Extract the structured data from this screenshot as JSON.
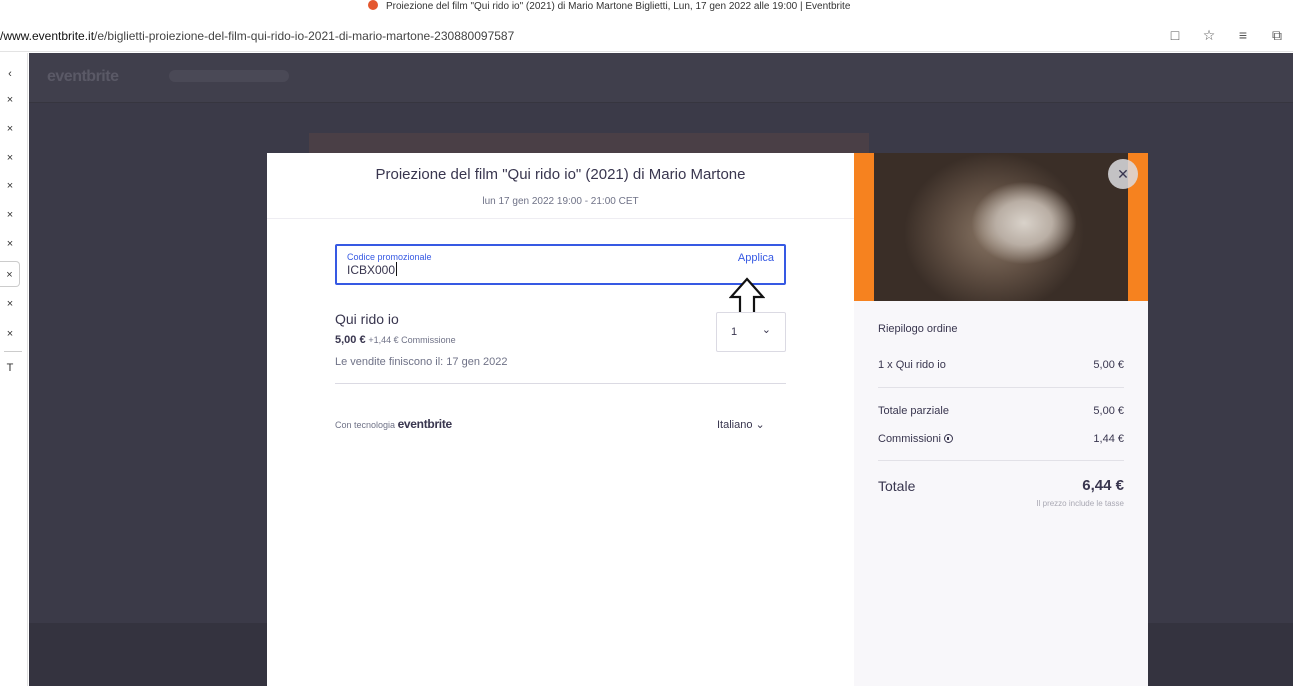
{
  "browser": {
    "tab_title": "Proiezione del film \"Qui rido io\" (2021) di Mario Martone Biglietti, Lun, 17 gen 2022 alle 19:00 | Eventbrite",
    "url_host": "/www.eventbrite.it",
    "url_path": "/e/biglietti-proiezione-del-film-qui-rido-io-2021-di-mario-martone-230880097587",
    "icons": [
      "reading-view-icon",
      "favorite-icon",
      "favorites-bar-icon",
      "collections-icon"
    ]
  },
  "vertical_tabs": {
    "collapse_glyph": "‹",
    "close_glyph": "×",
    "items_count_visible": 9,
    "last_glyph": "T"
  },
  "background_site": {
    "logo": "eventbrite"
  },
  "event": {
    "title": "Proiezione del film \"Qui rido io\" (2021) di Mario Martone",
    "date": "lun 17 gen 2022 19:00 - 21:00 CET"
  },
  "promo": {
    "label": "Codice promozionale",
    "value": "ICBX000",
    "apply_label": "Applica"
  },
  "ticket": {
    "name": "Qui rido io",
    "price": "5,00 €",
    "fee": "+1,44 € Commissione",
    "sales_end": "Le vendite finiscono il: 17 gen 2022",
    "quantity": "1"
  },
  "footer": {
    "powered_prefix": "Con tecnologia",
    "powered_brand": "eventbrite",
    "language": "Italiano"
  },
  "order": {
    "title": "Riepilogo ordine",
    "line_label": "1 x Qui rido io",
    "line_value": "5,00 €",
    "subtotal_label": "Totale parziale",
    "subtotal_value": "5,00 €",
    "fees_label": "Commissioni",
    "fees_value": "1,44 €",
    "total_label": "Totale",
    "total_value": "6,44 €",
    "tax_note": "Il prezzo include le tasse"
  },
  "colors": {
    "accent_blue": "#3659e3",
    "brand_orange": "#f6821f",
    "overlay": "#3b3a48",
    "text_dark": "#39364f"
  }
}
